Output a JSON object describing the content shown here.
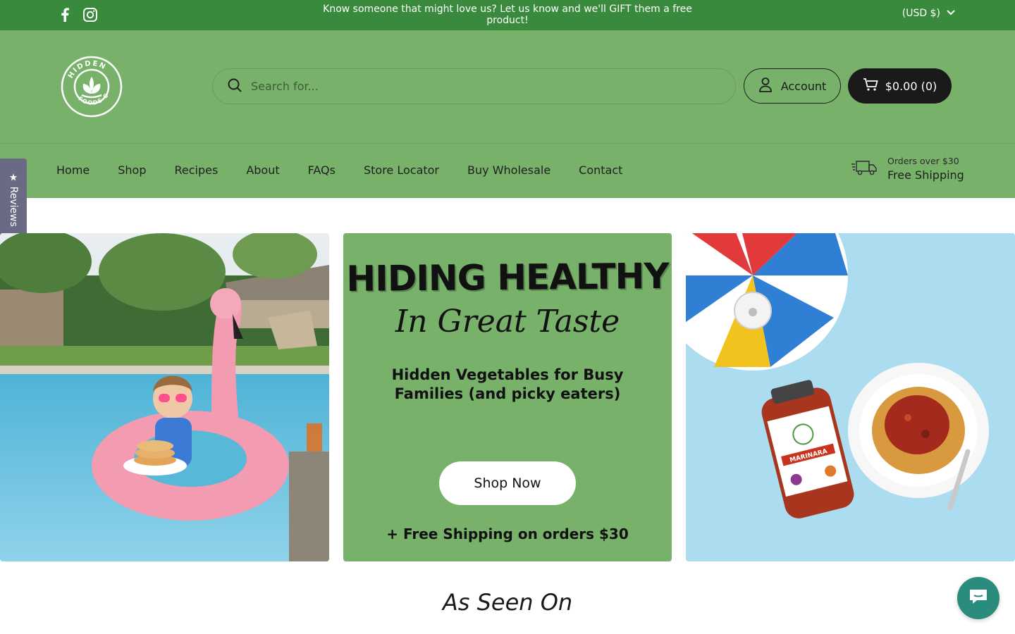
{
  "announcement": {
    "message": "Know someone that might love us? Let us know and we'll GIFT them a free product!",
    "currency": "(USD $)"
  },
  "header": {
    "logo_text_top": "HIDDEN",
    "logo_text_bottom": "FOODS CO.",
    "search_placeholder": "Search for...",
    "account_label": "Account",
    "cart_label": "$0.00 (0)"
  },
  "nav": {
    "items": [
      "Home",
      "Shop",
      "Recipes",
      "About",
      "FAQs",
      "Store Locator",
      "Buy Wholesale",
      "Contact"
    ],
    "shipping_small": "Orders over $30",
    "shipping_big": "Free Shipping"
  },
  "reviews_tab": {
    "label": "Reviews"
  },
  "hero": {
    "headline": "HIDING HEALTHY",
    "script": "In Great Taste",
    "tagline": "Hidden Vegetables for Busy Families (and picky eaters)",
    "cta": "Shop Now",
    "footer": "+ Free Shipping on orders $30"
  },
  "product": {
    "jar_label": "MARINARA"
  },
  "section": {
    "title": "As Seen On"
  },
  "colors": {
    "announce_bg": "#3a8a3e",
    "header_bg": "#77b16a",
    "cart_bg": "#1a1a1a",
    "reviews_bg": "#6a6a85",
    "chat_bg": "#2a8c7c"
  }
}
